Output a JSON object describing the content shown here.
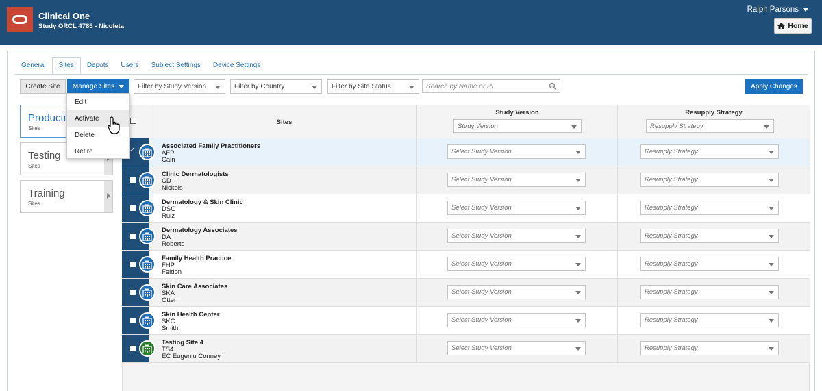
{
  "header": {
    "app_title": "Clinical One",
    "study_title": "Study ORCL 4785 - Nicoleta",
    "user_name": "Ralph Parsons",
    "home_label": "Home",
    "brand_color": "#1f4e79",
    "logo_color": "#c74634"
  },
  "tabs": [
    {
      "label": "General"
    },
    {
      "label": "Sites",
      "active": true
    },
    {
      "label": "Depots"
    },
    {
      "label": "Users"
    },
    {
      "label": "Subject Settings"
    },
    {
      "label": "Device Settings"
    }
  ],
  "toolbar": {
    "create_site": "Create Site",
    "manage_sites": "Manage Sites",
    "filter_study_version": "Filter by Study Version",
    "filter_country": "Filter by Country",
    "filter_site_status": "Filter by Site Status",
    "search_placeholder": "Search by Name or PI",
    "apply_changes": "Apply Changes"
  },
  "manage_menu": {
    "items": [
      "Edit",
      "Activate",
      "Delete",
      "Retire"
    ],
    "highlighted": "Activate"
  },
  "environments": [
    {
      "name": "Production",
      "sub": "Sites",
      "active": true
    },
    {
      "name": "Testing",
      "sub": "Sites"
    },
    {
      "name": "Training",
      "sub": "Sites"
    }
  ],
  "table": {
    "col_sites": "Sites",
    "col_study_version": "Study Version",
    "col_resupply": "Resupply Strategy",
    "study_version_filter": "Study Version",
    "resupply_filter": "Resupply Strategy",
    "row_version_placeholder": "Select Study Version",
    "row_resupply_placeholder": "Resupply Strategy",
    "rows": [
      {
        "name": "Associated Family Practitioners",
        "code": "AFP",
        "pi": "Cain",
        "selected": true
      },
      {
        "name": "Clinic Dermatologists",
        "code": "CD",
        "pi": "Nickols"
      },
      {
        "name": "Dermatology & Skin Clinic",
        "code": "DSC",
        "pi": "Ruiz"
      },
      {
        "name": "Dermatology Associates",
        "code": "DA",
        "pi": "Roberts"
      },
      {
        "name": "Family Health Practice",
        "code": "FHP",
        "pi": "Feldon"
      },
      {
        "name": "Skin Care Associates",
        "code": "SKA",
        "pi": "Otter"
      },
      {
        "name": "Skin Health Center",
        "code": "SKC",
        "pi": "Smith"
      },
      {
        "name": "Testing Site 4",
        "code": "TS4",
        "pi": "EC Eugeniu Conney",
        "icon_color": "green"
      }
    ]
  }
}
